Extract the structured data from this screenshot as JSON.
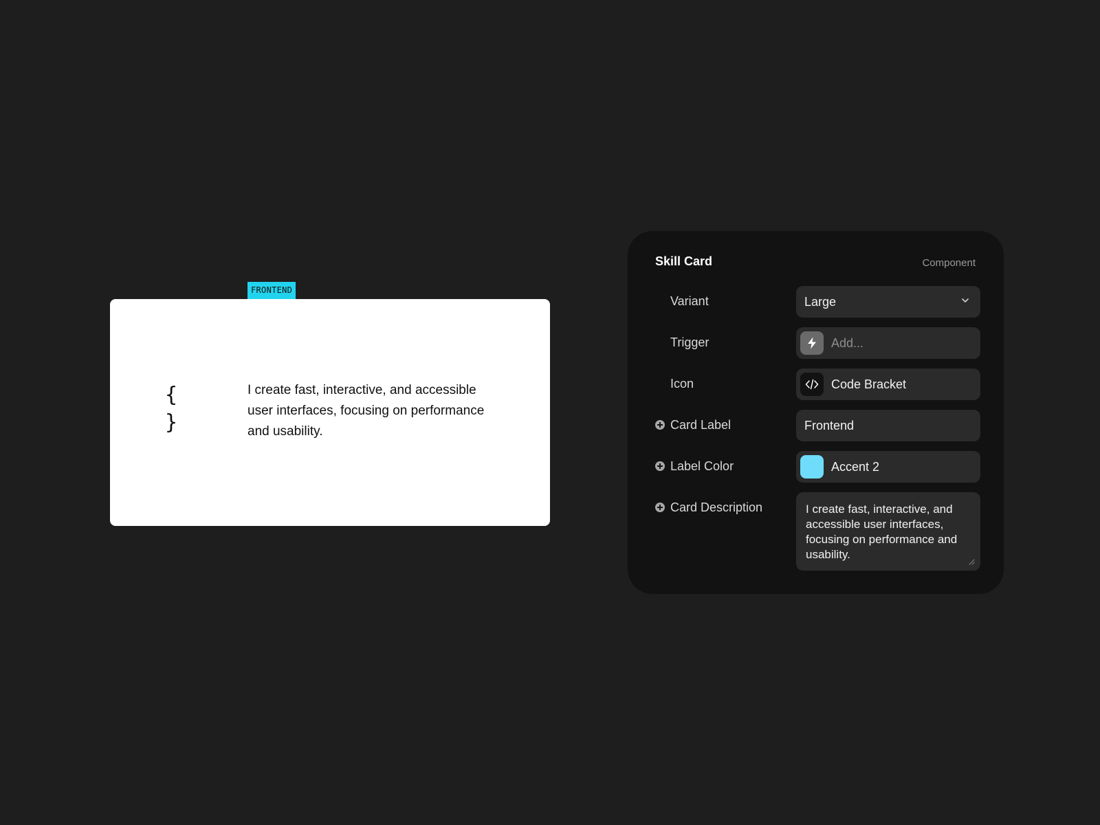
{
  "preview": {
    "label": "FRONTEND",
    "label_color": "#22d3ee",
    "icon": "curly-braces-icon",
    "icon_glyph": "{ }",
    "description": "I create fast, interactive, and accessible user interfaces, focusing on performance and usability."
  },
  "panel": {
    "title": "Skill Card",
    "type": "Component",
    "variant": {
      "label": "Variant",
      "value": "Large"
    },
    "trigger": {
      "label": "Trigger",
      "placeholder": "Add...",
      "icon": "lightning-bolt-icon"
    },
    "icon": {
      "label": "Icon",
      "value": "Code Bracket",
      "icon": "code-bracket-icon"
    },
    "card_label": {
      "label": "Card Label",
      "value": "Frontend"
    },
    "label_color": {
      "label": "Label Color",
      "value": "Accent 2",
      "swatch": "#6fdcfb"
    },
    "card_description": {
      "label": "Card Description",
      "value": "I create fast, interactive, and accessible user interfaces, focusing on performance and usability."
    }
  }
}
